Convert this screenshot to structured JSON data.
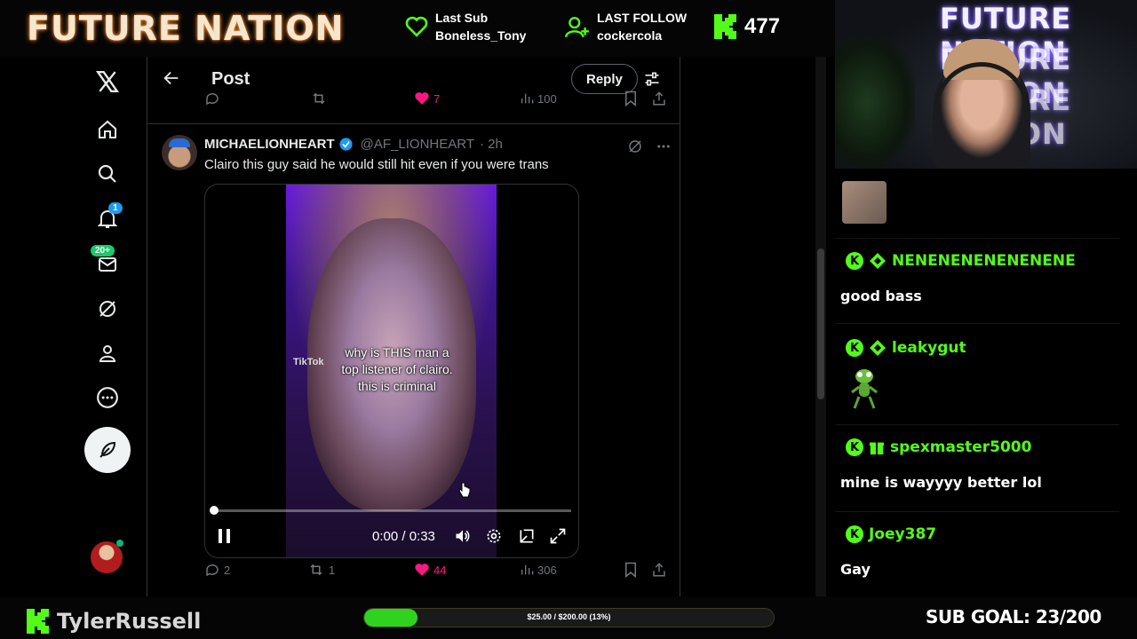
{
  "stream": {
    "brand": "FUTURE NATION",
    "last_sub_label": "Last Sub",
    "last_sub_value": "Boneless_Tony",
    "last_follow_label": "LAST FOLLOW",
    "last_follow_value": "cockercola",
    "viewer_count": "477",
    "streamer_name": "TylerRussell",
    "goal_text": "$25.00 / $200.00 (13%)",
    "goal_fraction": 0.13,
    "sub_goal": "SUB GOAL: 23/200",
    "accent_color": "#53fc18"
  },
  "nav": {
    "notifications_badge": "1",
    "messages_badge": "20+"
  },
  "header": {
    "title": "Post",
    "reply_label": "Reply"
  },
  "prev_tweet": {
    "like_count": "7",
    "views": "100"
  },
  "tweet": {
    "display_name": "MICHAELIONHEART",
    "handle": "@AF_LIONHEART",
    "time": "· 2h",
    "text": "Clairo this guy said he would still hit even if you were trans",
    "video_caption_1": "why is THIS man a",
    "video_caption_2": "top listener of clairo.",
    "video_caption_3": "this is criminal",
    "video_watermark": "TikTok",
    "video_time": "0:00 / 0:33",
    "video_progress": 0.01,
    "replies": "2",
    "reposts": "1",
    "likes": "44",
    "views": "306"
  },
  "chat": {
    "messages": [
      {
        "user": "NENENENENENENENE",
        "text": "good bass"
      },
      {
        "user": "leakygut",
        "text": ""
      },
      {
        "user": "spexmaster5000",
        "text": "mine is wayyyy better lol"
      },
      {
        "user": "Joey387",
        "text": "Gay"
      }
    ]
  }
}
